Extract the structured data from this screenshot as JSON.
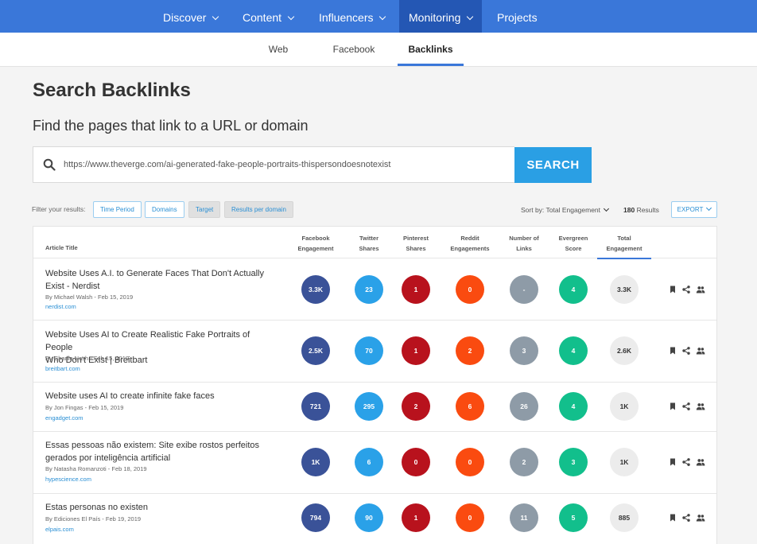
{
  "topnav": {
    "items": [
      {
        "label": "Discover"
      },
      {
        "label": "Content"
      },
      {
        "label": "Influencers"
      },
      {
        "label": "Monitoring"
      },
      {
        "label": "Projects"
      }
    ],
    "active": "Monitoring"
  },
  "subnav": {
    "tabs": [
      {
        "label": "Web"
      },
      {
        "label": "Facebook"
      },
      {
        "label": "Backlinks"
      }
    ],
    "active": "Backlinks"
  },
  "page": {
    "title": "Search Backlinks",
    "subtitle": "Find the pages that link to a URL or domain"
  },
  "search": {
    "value": "https://www.theverge.com/ai-generated-fake-people-portraits-thispersondoesnotexist",
    "button_label": "SEARCH"
  },
  "filters": {
    "label": "Filter your results:",
    "buttons": [
      {
        "label": "Time Period"
      },
      {
        "label": "Domains"
      },
      {
        "label": "Target"
      },
      {
        "label": "Results per domain"
      }
    ],
    "sort_label": "Sort by: Total Engagement",
    "results_count": "180",
    "results_suffix": "Results",
    "export_label": "EXPORT"
  },
  "table": {
    "headers": {
      "title": "Article Title",
      "facebook": [
        "Facebook",
        "Engagement"
      ],
      "twitter": [
        "Twitter",
        "Shares"
      ],
      "pinterest": [
        "Pinterest",
        "Shares"
      ],
      "reddit": [
        "Reddit",
        "Engagements"
      ],
      "links": [
        "Number of",
        "Links"
      ],
      "evergreen": [
        "Evergreen",
        "Score"
      ],
      "total": [
        "Total",
        "Engagement"
      ]
    },
    "rows": [
      {
        "title_line1": "Website Uses A.I. to Generate Faces That Don't Actually",
        "title_line2": "Exist - Nerdist",
        "byline": "By Michael Walsh - Feb 15, 2019",
        "domain": "nerdist.com",
        "facebook": "3.3K",
        "twitter": "23",
        "pinterest": "1",
        "reddit": "0",
        "links": "-",
        "evergreen": "4",
        "total": "3.3K"
      },
      {
        "title_line1": "Website Uses AI to Create Realistic Fake Portraits of People",
        "title_line2": "Who Don't Exist | Breitbart",
        "byline": "By Charlie Nash - Feb 15, 2019",
        "domain": "breitbart.com",
        "facebook": "2.5K",
        "twitter": "70",
        "pinterest": "1",
        "reddit": "2",
        "links": "3",
        "evergreen": "4",
        "total": "2.6K"
      },
      {
        "title_line1": "Website uses AI to create infinite fake faces",
        "title_line2": "",
        "byline": "By Jon Fingas - Feb 15, 2019",
        "domain": "engadget.com",
        "facebook": "721",
        "twitter": "295",
        "pinterest": "2",
        "reddit": "6",
        "links": "26",
        "evergreen": "4",
        "total": "1K"
      },
      {
        "title_line1": "Essas pessoas não existem: Site exibe rostos perfeitos",
        "title_line2": "gerados por inteligência artificial",
        "byline": "By Natasha Romanzoti - Feb 18, 2019",
        "domain": "hypescience.com",
        "facebook": "1K",
        "twitter": "6",
        "pinterest": "0",
        "reddit": "0",
        "links": "2",
        "evergreen": "3",
        "total": "1K"
      },
      {
        "title_line1": "Estas personas no existen",
        "title_line2": "",
        "byline": "By Ediciones El País - Feb 19, 2019",
        "domain": "elpais.com",
        "facebook": "794",
        "twitter": "90",
        "pinterest": "1",
        "reddit": "0",
        "links": "11",
        "evergreen": "5",
        "total": "885"
      }
    ]
  },
  "colors": {
    "topnav": "#3a77d9",
    "topnav_active": "#2457b4",
    "search_button": "#2a9fe4",
    "facebook": "#3a5298",
    "twitter": "#2aa1e8",
    "pinterest": "#b8121d",
    "reddit": "#fa4b10",
    "links": "#8e9ba7",
    "evergreen": "#12bf8c"
  }
}
